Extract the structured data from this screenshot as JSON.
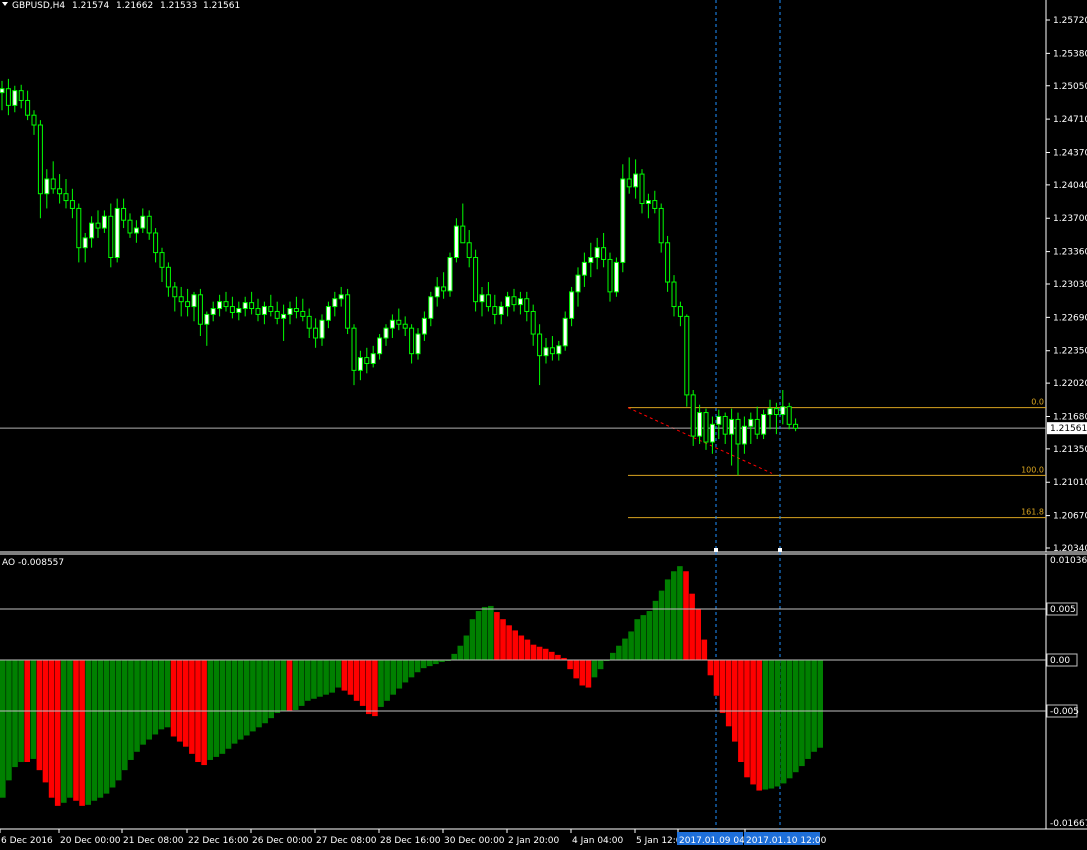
{
  "header": {
    "symbol": "GBPUSD,H4",
    "open": "1.21574",
    "high": "1.21662",
    "low": "1.21533",
    "close": "1.21561"
  },
  "indicator": {
    "label": "AO -0.008557"
  },
  "colors": {
    "background": "#000000",
    "candle_bull": "#ffffff",
    "candle_bear": "#000000",
    "candle_outline": "#00ff00",
    "ao_up": "#008000",
    "ao_down": "#ff0000",
    "fibo": "#daa520",
    "vline": "#1e90ff",
    "trend": "#ff0000",
    "bid_line": "#b0b0b0",
    "axis_text": "#ffffff",
    "time_highlight": "#1e6fd9"
  },
  "chart_data": [
    {
      "type": "candlestick",
      "ylim": [
        1.2034,
        1.259
      ],
      "price_axis_labels": [
        "1.25720",
        "1.25380",
        "1.25050",
        "1.24710",
        "1.24370",
        "1.24040",
        "1.23700",
        "1.23360",
        "1.23030",
        "1.22690",
        "1.22350",
        "1.22020",
        "1.21680",
        "1.21350",
        "1.21010",
        "1.20670",
        "1.20340"
      ],
      "current_price": "1.21561",
      "time_labels": [
        "6 Dec 2016",
        "20 Dec 00:00",
        "21 Dec 08:00",
        "22 Dec 16:00",
        "26 Dec 00:00",
        "27 Dec 08:00",
        "28 Dec 16:00",
        "30 Dec 00:00",
        "2 Jan 20:00",
        "4 Jan 04:00",
        "5 Jan 12:00",
        "2017.01.09 04:",
        "2017.01.10 12:00"
      ],
      "fibonacci": [
        {
          "level": "0.0",
          "price": 1.2177
        },
        {
          "level": "100.0",
          "price": 1.2108
        },
        {
          "level": "161.8",
          "price": 1.2065
        }
      ],
      "candles_ohlc": [
        [
          1.2498,
          1.251,
          1.248,
          1.2502
        ],
        [
          1.2502,
          1.2512,
          1.2475,
          1.2485
        ],
        [
          1.2485,
          1.2505,
          1.2478,
          1.25
        ],
        [
          1.25,
          1.2506,
          1.2482,
          1.249
        ],
        [
          1.249,
          1.25,
          1.247,
          1.2475
        ],
        [
          1.2475,
          1.248,
          1.2455,
          1.2465
        ],
        [
          1.2465,
          1.247,
          1.237,
          1.2395
        ],
        [
          1.2395,
          1.242,
          1.238,
          1.241
        ],
        [
          1.241,
          1.2428,
          1.2395,
          1.24
        ],
        [
          1.24,
          1.2415,
          1.2385,
          1.2395
        ],
        [
          1.2395,
          1.241,
          1.238,
          1.2388
        ],
        [
          1.2388,
          1.24,
          1.237,
          1.238
        ],
        [
          1.238,
          1.2385,
          1.2325,
          1.234
        ],
        [
          1.234,
          1.2355,
          1.2325,
          1.235
        ],
        [
          1.235,
          1.2372,
          1.234,
          1.2365
        ],
        [
          1.2365,
          1.2378,
          1.235,
          1.236
        ],
        [
          1.236,
          1.2378,
          1.2355,
          1.2372
        ],
        [
          1.2372,
          1.2385,
          1.232,
          1.233
        ],
        [
          1.233,
          1.239,
          1.2325,
          1.238
        ],
        [
          1.238,
          1.239,
          1.236,
          1.2368
        ],
        [
          1.2368,
          1.2375,
          1.235,
          1.2355
        ],
        [
          1.2355,
          1.2368,
          1.2345,
          1.236
        ],
        [
          1.236,
          1.238,
          1.2355,
          1.2372
        ],
        [
          1.2372,
          1.2378,
          1.2348,
          1.2355
        ],
        [
          1.2355,
          1.236,
          1.2325,
          1.2335
        ],
        [
          1.2335,
          1.234,
          1.2305,
          1.232
        ],
        [
          1.232,
          1.2325,
          1.229,
          1.23
        ],
        [
          1.23,
          1.2305,
          1.2275,
          1.229
        ],
        [
          1.229,
          1.23,
          1.227,
          1.2285
        ],
        [
          1.2285,
          1.2298,
          1.227,
          1.228
        ],
        [
          1.228,
          1.2295,
          1.2265,
          1.2292
        ],
        [
          1.2292,
          1.2298,
          1.225,
          1.2262
        ],
        [
          1.2262,
          1.2275,
          1.224,
          1.2272
        ],
        [
          1.2272,
          1.2285,
          1.2265,
          1.2278
        ],
        [
          1.2278,
          1.2292,
          1.227,
          1.2285
        ],
        [
          1.2285,
          1.2295,
          1.2275,
          1.228
        ],
        [
          1.228,
          1.229,
          1.2268,
          1.2274
        ],
        [
          1.2274,
          1.2285,
          1.2266,
          1.2278
        ],
        [
          1.2278,
          1.229,
          1.227,
          1.2284
        ],
        [
          1.2284,
          1.2295,
          1.2272,
          1.2278
        ],
        [
          1.2278,
          1.2288,
          1.2265,
          1.2272
        ],
        [
          1.2272,
          1.2285,
          1.2262,
          1.228
        ],
        [
          1.228,
          1.2292,
          1.227,
          1.2275
        ],
        [
          1.2275,
          1.2285,
          1.2262,
          1.2268
        ],
        [
          1.2268,
          1.2282,
          1.2245,
          1.2272
        ],
        [
          1.2272,
          1.2285,
          1.2262,
          1.2278
        ],
        [
          1.2278,
          1.229,
          1.2268,
          1.2275
        ],
        [
          1.2275,
          1.2288,
          1.2265,
          1.227
        ],
        [
          1.227,
          1.2278,
          1.2248,
          1.2258
        ],
        [
          1.2258,
          1.2268,
          1.2238,
          1.2248
        ],
        [
          1.2248,
          1.2272,
          1.224,
          1.2266
        ],
        [
          1.2266,
          1.2285,
          1.2258,
          1.228
        ],
        [
          1.228,
          1.2295,
          1.227,
          1.2288
        ],
        [
          1.2288,
          1.23,
          1.228,
          1.2292
        ],
        [
          1.2292,
          1.2298,
          1.2252,
          1.2258
        ],
        [
          1.2258,
          1.2262,
          1.22,
          1.2215
        ],
        [
          1.2215,
          1.2235,
          1.2205,
          1.2228
        ],
        [
          1.2228,
          1.2238,
          1.2212,
          1.2222
        ],
        [
          1.2222,
          1.224,
          1.2218,
          1.2232
        ],
        [
          1.2232,
          1.2252,
          1.2226,
          1.2248
        ],
        [
          1.2248,
          1.2262,
          1.224,
          1.2258
        ],
        [
          1.2258,
          1.2272,
          1.2248,
          1.2266
        ],
        [
          1.2266,
          1.2278,
          1.2256,
          1.2262
        ],
        [
          1.2262,
          1.227,
          1.225,
          1.2258
        ],
        [
          1.2258,
          1.2262,
          1.2222,
          1.2232
        ],
        [
          1.2232,
          1.2258,
          1.2226,
          1.2252
        ],
        [
          1.2252,
          1.2275,
          1.2245,
          1.2268
        ],
        [
          1.2268,
          1.2295,
          1.226,
          1.229
        ],
        [
          1.229,
          1.231,
          1.228,
          1.23
        ],
        [
          1.23,
          1.2315,
          1.2288,
          1.2296
        ],
        [
          1.2296,
          1.2335,
          1.229,
          1.233
        ],
        [
          1.233,
          1.237,
          1.2325,
          1.2362
        ],
        [
          1.2362,
          1.2385,
          1.235,
          1.2345
        ],
        [
          1.2345,
          1.2358,
          1.232,
          1.233
        ],
        [
          1.233,
          1.2338,
          1.2275,
          1.2285
        ],
        [
          1.2285,
          1.23,
          1.227,
          1.2292
        ],
        [
          1.2292,
          1.2305,
          1.2275,
          1.228
        ],
        [
          1.228,
          1.2292,
          1.2262,
          1.2272
        ],
        [
          1.2272,
          1.2285,
          1.2262,
          1.228
        ],
        [
          1.228,
          1.2295,
          1.227,
          1.229
        ],
        [
          1.229,
          1.2298,
          1.2275,
          1.2282
        ],
        [
          1.2282,
          1.2295,
          1.2272,
          1.2288
        ],
        [
          1.2288,
          1.2295,
          1.2265,
          1.2275
        ],
        [
          1.2275,
          1.2282,
          1.224,
          1.2252
        ],
        [
          1.2252,
          1.2262,
          1.22,
          1.223
        ],
        [
          1.223,
          1.2248,
          1.2222,
          1.2238
        ],
        [
          1.2238,
          1.225,
          1.2225,
          1.2232
        ],
        [
          1.2232,
          1.2245,
          1.2225,
          1.224
        ],
        [
          1.224,
          1.2275,
          1.2235,
          1.2268
        ],
        [
          1.2268,
          1.23,
          1.226,
          1.2295
        ],
        [
          1.2295,
          1.232,
          1.228,
          1.2312
        ],
        [
          1.2312,
          1.2335,
          1.23,
          1.2325
        ],
        [
          1.2325,
          1.2345,
          1.231,
          1.233
        ],
        [
          1.233,
          1.235,
          1.2318,
          1.234
        ],
        [
          1.234,
          1.2355,
          1.232,
          1.2328
        ],
        [
          1.2328,
          1.2335,
          1.2285,
          1.2295
        ],
        [
          1.2295,
          1.233,
          1.229,
          1.2325
        ],
        [
          1.2325,
          1.2425,
          1.2315,
          1.241
        ],
        [
          1.241,
          1.2432,
          1.2395,
          1.2402
        ],
        [
          1.2402,
          1.243,
          1.239,
          1.2415
        ],
        [
          1.2415,
          1.242,
          1.2375,
          1.2385
        ],
        [
          1.2385,
          1.2395,
          1.237,
          1.2388
        ],
        [
          1.2388,
          1.2398,
          1.2375,
          1.238
        ],
        [
          1.238,
          1.2385,
          1.2335,
          1.2345
        ],
        [
          1.2345,
          1.2352,
          1.2295,
          1.2305
        ],
        [
          1.2305,
          1.2312,
          1.227,
          1.228
        ],
        [
          1.228,
          1.2285,
          1.226,
          1.227
        ],
        [
          1.227,
          1.2272,
          1.2178,
          1.219
        ],
        [
          1.219,
          1.2195,
          1.2138,
          1.2148
        ],
        [
          1.2148,
          1.218,
          1.214,
          1.2172
        ],
        [
          1.2172,
          1.2176,
          1.2134,
          1.2142
        ],
        [
          1.2142,
          1.2168,
          1.213,
          1.216
        ],
        [
          1.216,
          1.2175,
          1.2145,
          1.2168
        ],
        [
          1.2168,
          1.2172,
          1.214,
          1.215
        ],
        [
          1.215,
          1.2176,
          1.2118,
          1.2165
        ],
        [
          1.2165,
          1.2172,
          1.2108,
          1.214
        ],
        [
          1.214,
          1.2168,
          1.213,
          1.2158
        ],
        [
          1.2158,
          1.2172,
          1.214,
          1.2165
        ],
        [
          1.2165,
          1.2178,
          1.2145,
          1.215
        ],
        [
          1.215,
          1.2175,
          1.2145,
          1.217
        ],
        [
          1.217,
          1.2185,
          1.2155,
          1.2176
        ],
        [
          1.2176,
          1.2182,
          1.215,
          1.217
        ],
        [
          1.217,
          1.2195,
          1.216,
          1.2178
        ],
        [
          1.2178,
          1.2182,
          1.2155,
          1.216
        ],
        [
          1.216,
          1.2166,
          1.2153,
          1.2156
        ]
      ]
    },
    {
      "type": "bar",
      "title": "AO -0.008557",
      "ylim": [
        -0.01667,
        0.01036
      ],
      "axis_labels": [
        "0.01036",
        "0.005",
        "0.00",
        "-0.005",
        "-0.01667"
      ],
      "value_colors": [
        "green",
        "red"
      ],
      "values": [
        -0.0135,
        -0.0118,
        -0.0105,
        -0.01,
        -0.01,
        -0.0097,
        -0.0108,
        -0.012,
        -0.0135,
        -0.0143,
        -0.014,
        -0.0135,
        -0.0138,
        -0.0143,
        -0.0142,
        -0.0138,
        -0.0135,
        -0.0131,
        -0.0125,
        -0.0118,
        -0.0108,
        -0.0098,
        -0.009,
        -0.0083,
        -0.0078,
        -0.0073,
        -0.0068,
        -0.0066,
        -0.0075,
        -0.008,
        -0.0085,
        -0.0092,
        -0.01,
        -0.0103,
        -0.0098,
        -0.0095,
        -0.0092,
        -0.0087,
        -0.0082,
        -0.0078,
        -0.0074,
        -0.007,
        -0.0066,
        -0.0062,
        -0.0057,
        -0.0052,
        -0.005,
        -0.005,
        -0.0049,
        -0.0045,
        -0.004,
        -0.0038,
        -0.0036,
        -0.0034,
        -0.0032,
        -0.0027,
        -0.003,
        -0.0034,
        -0.004,
        -0.0045,
        -0.0053,
        -0.0055,
        -0.0046,
        -0.004,
        -0.0034,
        -0.0028,
        -0.0022,
        -0.0017,
        -0.0012,
        -0.0008,
        -0.0006,
        -0.0004,
        -0.0002,
        0.0,
        0.0006,
        0.0014,
        0.0024,
        0.004,
        0.0048,
        0.0052,
        0.0053,
        0.0047,
        0.004,
        0.0034,
        0.0029,
        0.0024,
        0.002,
        0.0015,
        0.0013,
        0.0011,
        0.0008,
        0.0005,
        0.0002,
        -0.0009,
        -0.0018,
        -0.0025,
        -0.0027,
        -0.0017,
        -0.0009,
        -0.0001,
        0.0007,
        0.0014,
        0.0021,
        0.0028,
        0.004,
        0.0044,
        0.0048,
        0.0058,
        0.0068,
        0.0079,
        0.0087,
        0.0092,
        0.0087,
        0.0065,
        0.005,
        0.002,
        -0.0015,
        -0.0035,
        -0.0052,
        -0.0065,
        -0.008,
        -0.01,
        -0.0115,
        -0.0122,
        -0.0128,
        -0.0127,
        -0.0126,
        -0.0124,
        -0.0121,
        -0.0116,
        -0.011,
        -0.0104,
        -0.0097,
        -0.009,
        -0.0086
      ]
    }
  ]
}
